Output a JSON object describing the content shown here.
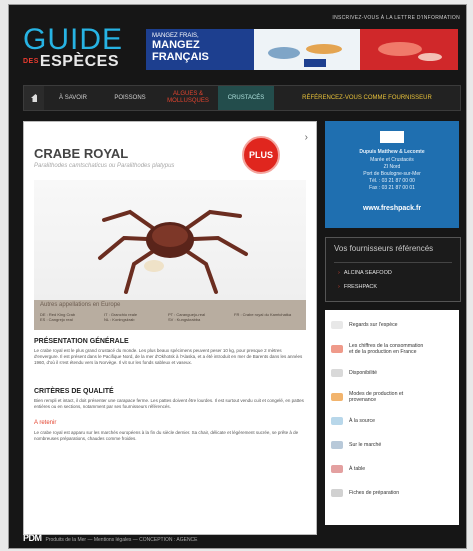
{
  "header": {
    "logo_line1": "GUIDE",
    "logo_des": "DES",
    "logo_line2": "ESPÈCES",
    "newsletter": "INSCRIVEZ-VOUS À LA LETTRE D'INFORMATION",
    "banner_small": "MANGEZ FRAIS,",
    "banner_big": "MANGEZ FRANÇAIS"
  },
  "nav": {
    "home_icon": "home-icon",
    "items": [
      "À SAVOIR",
      "POISSONS",
      "ALGUES &\nMOLLUSQUES",
      "CRUSTACÉS",
      "RÉFÉRENCEZ-VOUS COMME FOURNISSEUR"
    ]
  },
  "product": {
    "title": "CRABE ROYAL",
    "subtitle": "Paralithodes camtschaticus ou Paralithodes platypus",
    "plus_label": "PLUS",
    "caption": "Autres appellations en Europe",
    "caption_cols": [
      "DE : Red King Crab\nES : Cangrejo real",
      "IT : Granchio reale\nNL : Koningskrab",
      "PT : Caranguejo-real\nSV : Kungskrabba",
      "FR : Crabe royal du Kamtchatka"
    ]
  },
  "sections": {
    "general_title": "PRÉSENTATION GÉNÉRALE",
    "general_text": "Le crabe royal est le plus grand crustacé du monde. Les plus beaux spécimens peuvent peser 10 kg, pour presque 2 mètres d'envergure. Il est présent dans le Pacifique Nord, de la mer d'Okhotsk à l'Alaska, et a été introduit en mer de Barents dans les années 1960, d'où il s'est étendu vers la Norvège. Il vit sur les fonds sableux et vaseux.",
    "quality_title": "CRITÈRES DE QUALITÉ",
    "quality_text": "Bien rempli et intact, il doit présenter une carapace ferme. Les pattes doivent être lourdes. Il est surtout vendu cuit et congelé, en pattes entières ou en sections, notamment par ses fournisseurs référencés.",
    "history_sub": "A retenir",
    "history_text": "Le crabe royal est apparu sur les marchés européens à la fin du siècle dernier. Sa chair, délicate et légèrement sucrée, se prête à de nombreuses préparations, chaudes comme froides."
  },
  "sidebar_ad": {
    "company": "Dupuis Matthew & Lecomte",
    "lines": [
      "Marée et Crustacés",
      "ZI Nord",
      "Port de Boulogne-sur-Mer",
      "Tél. : 03 21 87 00 00",
      "Fax : 03 21 87 00 01"
    ],
    "website": "www.freshpack.fr"
  },
  "suppliers": {
    "heading": "Vos fournisseurs référencés",
    "items": [
      "ALCINA SEAFOOD",
      "FRESHPACK"
    ]
  },
  "side_links": [
    {
      "label": "Regards sur l'espèce",
      "color": "#e8e8e8"
    },
    {
      "label": "Les chiffres de la consommation\net de la production en France",
      "color": "#ef9a8a"
    },
    {
      "label": "Disponibilité",
      "color": "#d9d9d9"
    },
    {
      "label": "Modes de production et\nprovenance",
      "color": "#f2b46d"
    },
    {
      "label": "À la source",
      "color": "#b8d7ea"
    },
    {
      "label": "Sur le marché",
      "color": "#b8c9d9"
    },
    {
      "label": "À table",
      "color": "#e3a0a0"
    },
    {
      "label": "Fiches de préparation",
      "color": "#d1d1d1"
    }
  ],
  "footer": {
    "brand": "PDM",
    "text": "Produits de la Mer — Mentions légales — CONCEPTION : AGENCE"
  }
}
